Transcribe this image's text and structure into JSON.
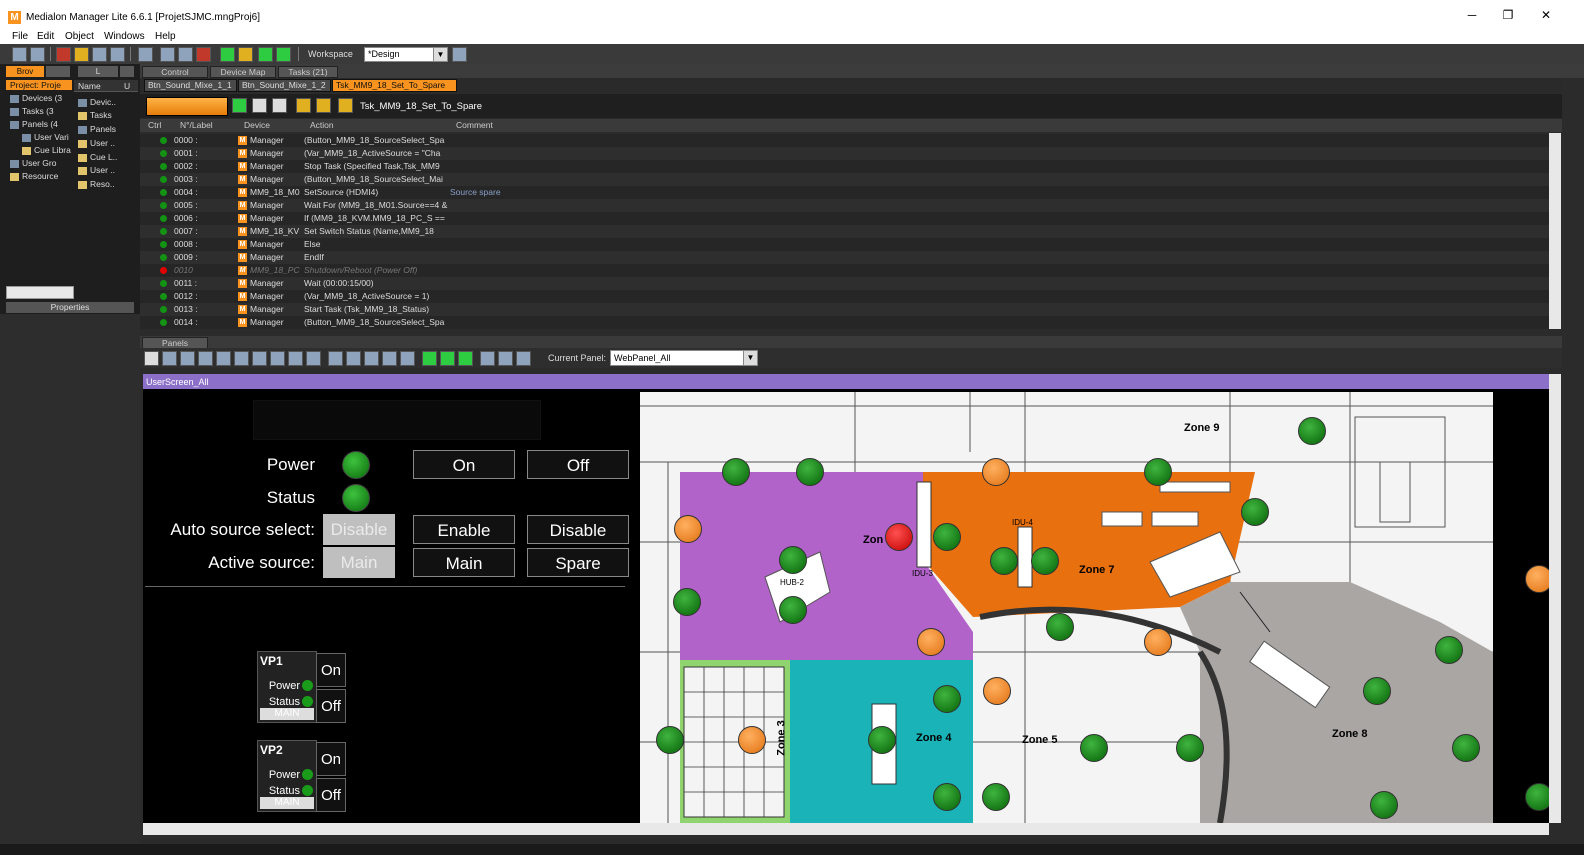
{
  "window": {
    "title": "Medialon Manager Lite 6.6.1  [ProjetSJMC.mngProj6]",
    "app_icon": "M"
  },
  "window_controls": {
    "minimize": "─",
    "maximize": "❐",
    "close": "✕"
  },
  "menu": [
    "File",
    "Edit",
    "Object",
    "Windows",
    "Help"
  ],
  "toolbar": {
    "workspace_label": "Workspace",
    "workspace_value": "*Design"
  },
  "left_tabs": {
    "browser": "Brov",
    "list": "L"
  },
  "tree": [
    {
      "label": "Project: Proje"
    },
    {
      "label": "Devices (3"
    },
    {
      "label": "Tasks (3"
    },
    {
      "label": "Panels (4"
    },
    {
      "label": "User Vari"
    },
    {
      "label": "Cue Libra"
    },
    {
      "label": "User Gro"
    },
    {
      "label": "Resource"
    }
  ],
  "tree2_header": {
    "name": "Name",
    "u": "U"
  },
  "tree2": [
    "Devic..",
    "Tasks",
    "Panels",
    "User ..",
    "Cue L..",
    "User ..",
    "Reso.."
  ],
  "properties_label": "Properties",
  "main_tabs": [
    "Control",
    "Device Map",
    "Tasks (21)"
  ],
  "task_tabs": [
    "Btn_Sound_Mixe_1_1",
    "Btn_Sound_Mixe_1_2",
    "Tsk_MM9_18_Set_To_Spare"
  ],
  "task_name": "Tsk_MM9_18_Set_To_Spare",
  "task_headers": {
    "ctrl": "Ctrl",
    "label": "N°/Label",
    "device": "Device",
    "action": "Action",
    "comment": "Comment"
  },
  "task_rows": [
    {
      "num": "0000 :",
      "device": "Manager",
      "action": "(Button_MM9_18_SourceSelect_Spa",
      "comment": "",
      "status": "green"
    },
    {
      "num": "0001 :",
      "device": "Manager",
      "action": "(Var_MM9_18_ActiveSource = \"Cha",
      "comment": "",
      "status": "green"
    },
    {
      "num": "0002 :",
      "device": "Manager",
      "action": "Stop Task (Specified Task,Tsk_MM9",
      "comment": "",
      "status": "green"
    },
    {
      "num": "0003 :",
      "device": "Manager",
      "action": "(Button_MM9_18_SourceSelect_Mai",
      "comment": "",
      "status": "green"
    },
    {
      "num": "0004 :",
      "device": "MM9_18_M0",
      "action": "SetSource (HDMI4)",
      "comment": "Source spare",
      "status": "green"
    },
    {
      "num": "0005 :",
      "device": "Manager",
      "action": "Wait For (MM9_18_M01.Source==4 &",
      "comment": "",
      "status": "green"
    },
    {
      "num": "0006 :",
      "device": "Manager",
      "action": "If (MM9_18_KVM.MM9_18_PC_S ==",
      "comment": "",
      "status": "green"
    },
    {
      "num": "0007 :",
      "device": "MM9_18_KV",
      "action": "   Set Switch Status (Name,MM9_18",
      "comment": "",
      "status": "green"
    },
    {
      "num": "0008 :",
      "device": "Manager",
      "action": "Else",
      "comment": "",
      "status": "green"
    },
    {
      "num": "0009 :",
      "device": "Manager",
      "action": "EndIf",
      "comment": "",
      "status": "green"
    },
    {
      "num": "0010",
      "device": "MM9_18_PC",
      "action": "Shutdown/Reboot (Power Off)",
      "comment": "",
      "status": "red"
    },
    {
      "num": "0011 :",
      "device": "Manager",
      "action": "Wait (00:00:15/00)",
      "comment": "",
      "status": "green"
    },
    {
      "num": "0012 :",
      "device": "Manager",
      "action": "(Var_MM9_18_ActiveSource = 1)",
      "comment": "",
      "status": "green"
    },
    {
      "num": "0013 :",
      "device": "Manager",
      "action": "Start Task (Tsk_MM9_18_Status)",
      "comment": "",
      "status": "green"
    },
    {
      "num": "0014 :",
      "device": "Manager",
      "action": "(Button_MM9_18_SourceSelect_Spa",
      "comment": "",
      "status": "green"
    }
  ],
  "panels_label": "Panels",
  "current_panel_label": "Current Panel:",
  "current_panel_value": "WebPanel_All",
  "screen_title": "UserScreen_All",
  "controls": {
    "power_label": "Power",
    "status_label": "Status",
    "auto_source_label": "Auto source select:",
    "active_source_label": "Active source:",
    "auto_source_value": "Disable",
    "active_source_value": "Main",
    "on": "On",
    "off": "Off",
    "enable": "Enable",
    "disable": "Disable",
    "main": "Main",
    "spare": "Spare"
  },
  "vp": [
    {
      "title": "VP1",
      "power": "Power",
      "status": "Status",
      "mode": "MAIN",
      "on": "On",
      "off": "Off"
    },
    {
      "title": "VP2",
      "power": "Power",
      "status": "Status",
      "mode": "MAIN",
      "on": "On",
      "off": "Off"
    }
  ],
  "floor": {
    "zones": [
      "Zone 9",
      "Zone 7",
      "Zone 3",
      "Zone 4",
      "Zone 5",
      "Zone 8",
      "Zon"
    ],
    "labels": [
      "IDU-4",
      "IDU-3",
      "HUB-2"
    ],
    "zone_colors": {
      "purple": "#b263c9",
      "orange": "#e8700e",
      "teal": "#1ab3b8",
      "green": "#8fd46e",
      "grey": "#a9a6a3"
    },
    "dot_colors": {
      "green": "#149214",
      "orange": "#f8941f",
      "red": "#e00000"
    }
  }
}
